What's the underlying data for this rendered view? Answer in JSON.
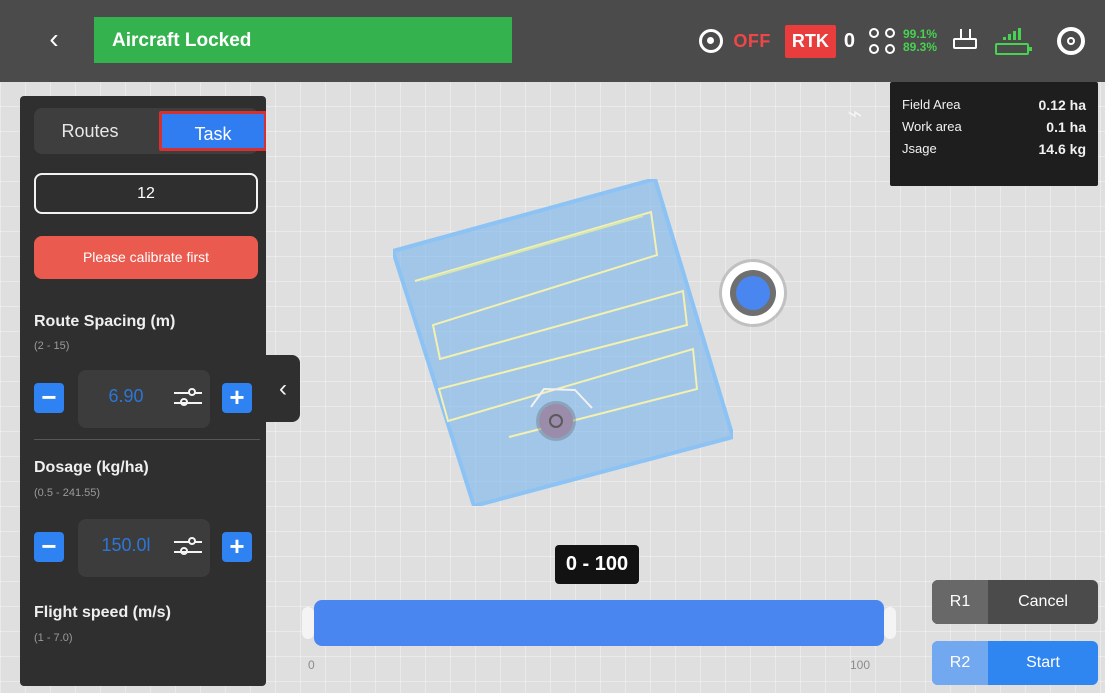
{
  "topbar": {
    "status": "Aircraft Locked",
    "gnss_state": "OFF",
    "rtk_label": "RTK",
    "rtk_count": "0",
    "battery_1": "99.1%",
    "battery_2": "89.3%"
  },
  "left_panel": {
    "tabs": {
      "routes": "Routes",
      "task": "Task"
    },
    "field_number": "12",
    "warning": "Please calibrate first",
    "route_spacing": {
      "title": "Route Spacing (m)",
      "range": "(2 - 15)",
      "value": "6.90"
    },
    "dosage": {
      "title": "Dosage (kg/ha)",
      "range": "(0.5 - 241.55)",
      "value": "150.0l"
    },
    "flight_speed": {
      "title": "Flight speed (m/s)",
      "range": "(1 - 7.0)"
    }
  },
  "stats": {
    "field_area_label": "Field Area",
    "field_area_value": "0.12 ha",
    "work_area_label": "Work area",
    "work_area_value": "0.1 ha",
    "usage_label": "Jsage",
    "usage_value": "14.6 kg"
  },
  "range": {
    "label": "0 - 100",
    "min_label": "0",
    "max_label": "100",
    "progress": 1.0
  },
  "actions": {
    "cancel_key": "R1",
    "cancel_label": "Cancel",
    "start_key": "R2",
    "start_label": "Start"
  },
  "icons": {
    "back": "chevron-left-icon",
    "gnss": "gnss-icon",
    "drone": "drone-icon",
    "remote": "remote-controller-icon",
    "signal_battery": "signal-battery-icon",
    "settings": "gear-icon",
    "map_tools": [
      "route-tool-icon",
      "point-tool-icon",
      "auto-route-icon",
      "location-target-icon",
      "grid-tool-icon"
    ],
    "collapse": "chevron-left-icon"
  },
  "colors": {
    "status_green": "#34b24d",
    "accent_blue": "#2f7df0",
    "warning_red": "#ea5a4f",
    "field_blue": "#73aee8"
  }
}
